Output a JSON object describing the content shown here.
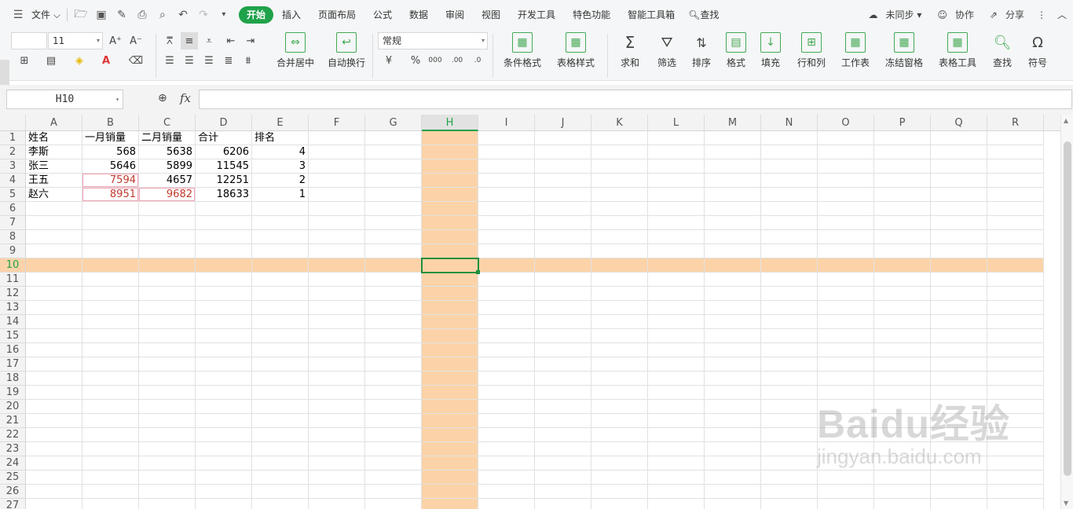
{
  "menubar": {
    "file_label": "文件",
    "tabs": [
      {
        "label": "开始",
        "active": true
      },
      {
        "label": "插入"
      },
      {
        "label": "页面布局"
      },
      {
        "label": "公式"
      },
      {
        "label": "数据"
      },
      {
        "label": "审阅"
      },
      {
        "label": "视图"
      },
      {
        "label": "开发工具"
      },
      {
        "label": "特色功能"
      },
      {
        "label": "智能工具箱"
      }
    ],
    "search_label": "查找",
    "sync_label": "未同步",
    "collab_label": "协作",
    "share_label": "分享"
  },
  "ribbon": {
    "font_name": "",
    "font_size": "11",
    "number_format": "常规",
    "merge_label": "合并居中",
    "wrap_label": "自动换行",
    "cond_format_label": "条件格式",
    "table_style_label": "表格样式",
    "sum_label": "求和",
    "filter_label": "筛选",
    "sort_label": "排序",
    "format_label": "格式",
    "fill_label": "填充",
    "rowcol_label": "行和列",
    "sheet_label": "工作表",
    "freeze_label": "冻结窗格",
    "tabletools_label": "表格工具",
    "find_label": "查找",
    "symbol_label": "符号"
  },
  "formula_bar": {
    "name_box": "H10",
    "fx_label": "fx",
    "formula": ""
  },
  "sheet": {
    "columns": [
      "A",
      "B",
      "C",
      "D",
      "E",
      "F",
      "G",
      "H",
      "I",
      "J",
      "K",
      "L",
      "M",
      "N",
      "O",
      "P",
      "Q",
      "R"
    ],
    "selected_column": "H",
    "selected_row": 10,
    "row_count": 27,
    "data": [
      [
        "姓名",
        "一月销量",
        "二月销量",
        "合计",
        "排名"
      ],
      [
        "李斯",
        "568",
        "5638",
        "6206",
        "4"
      ],
      [
        "张三",
        "5646",
        "5899",
        "11545",
        "3"
      ],
      [
        "王五",
        "7594",
        "4657",
        "12251",
        "2"
      ],
      [
        "赵六",
        "8951",
        "9682",
        "18633",
        "1"
      ]
    ],
    "highlight_color": "#fcd3a8",
    "accent_color": "#1fa24a"
  },
  "watermark": {
    "line1": "Baidu经验",
    "line2": "jingyan.baidu.com"
  }
}
